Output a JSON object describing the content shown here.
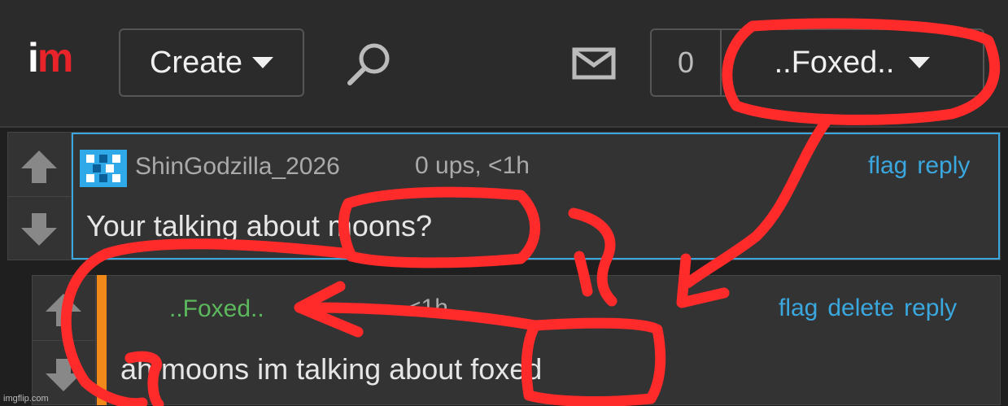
{
  "header": {
    "logo": {
      "i": "i",
      "m": "m"
    },
    "create_label": "Create",
    "notification_count": "0",
    "username": "..Foxed.."
  },
  "comments": [
    {
      "username": "ShinGodzilla_2026",
      "meta": "0 ups, <1h",
      "actions": [
        "flag",
        "reply"
      ],
      "text": "Your talking about moons?",
      "colors": {
        "username": "#aaaaaa",
        "border": "#3aa7df"
      }
    },
    {
      "username": "..Foxed..",
      "meta": "<1h",
      "actions": [
        "flag",
        "delete",
        "reply"
      ],
      "text": "ah moons im talking about foxed",
      "colors": {
        "username": "#5cb85c",
        "bar": "#f0891a"
      }
    }
  ],
  "watermark": "imgflip.com",
  "icons": [
    "search-icon",
    "mail-icon",
    "chevron-down-icon",
    "upvote-arrow-icon",
    "downvote-arrow-icon"
  ],
  "colors": {
    "accent": "#3aa7df",
    "brand_red": "#e8232a",
    "annotation_red": "#ff2a2a"
  }
}
